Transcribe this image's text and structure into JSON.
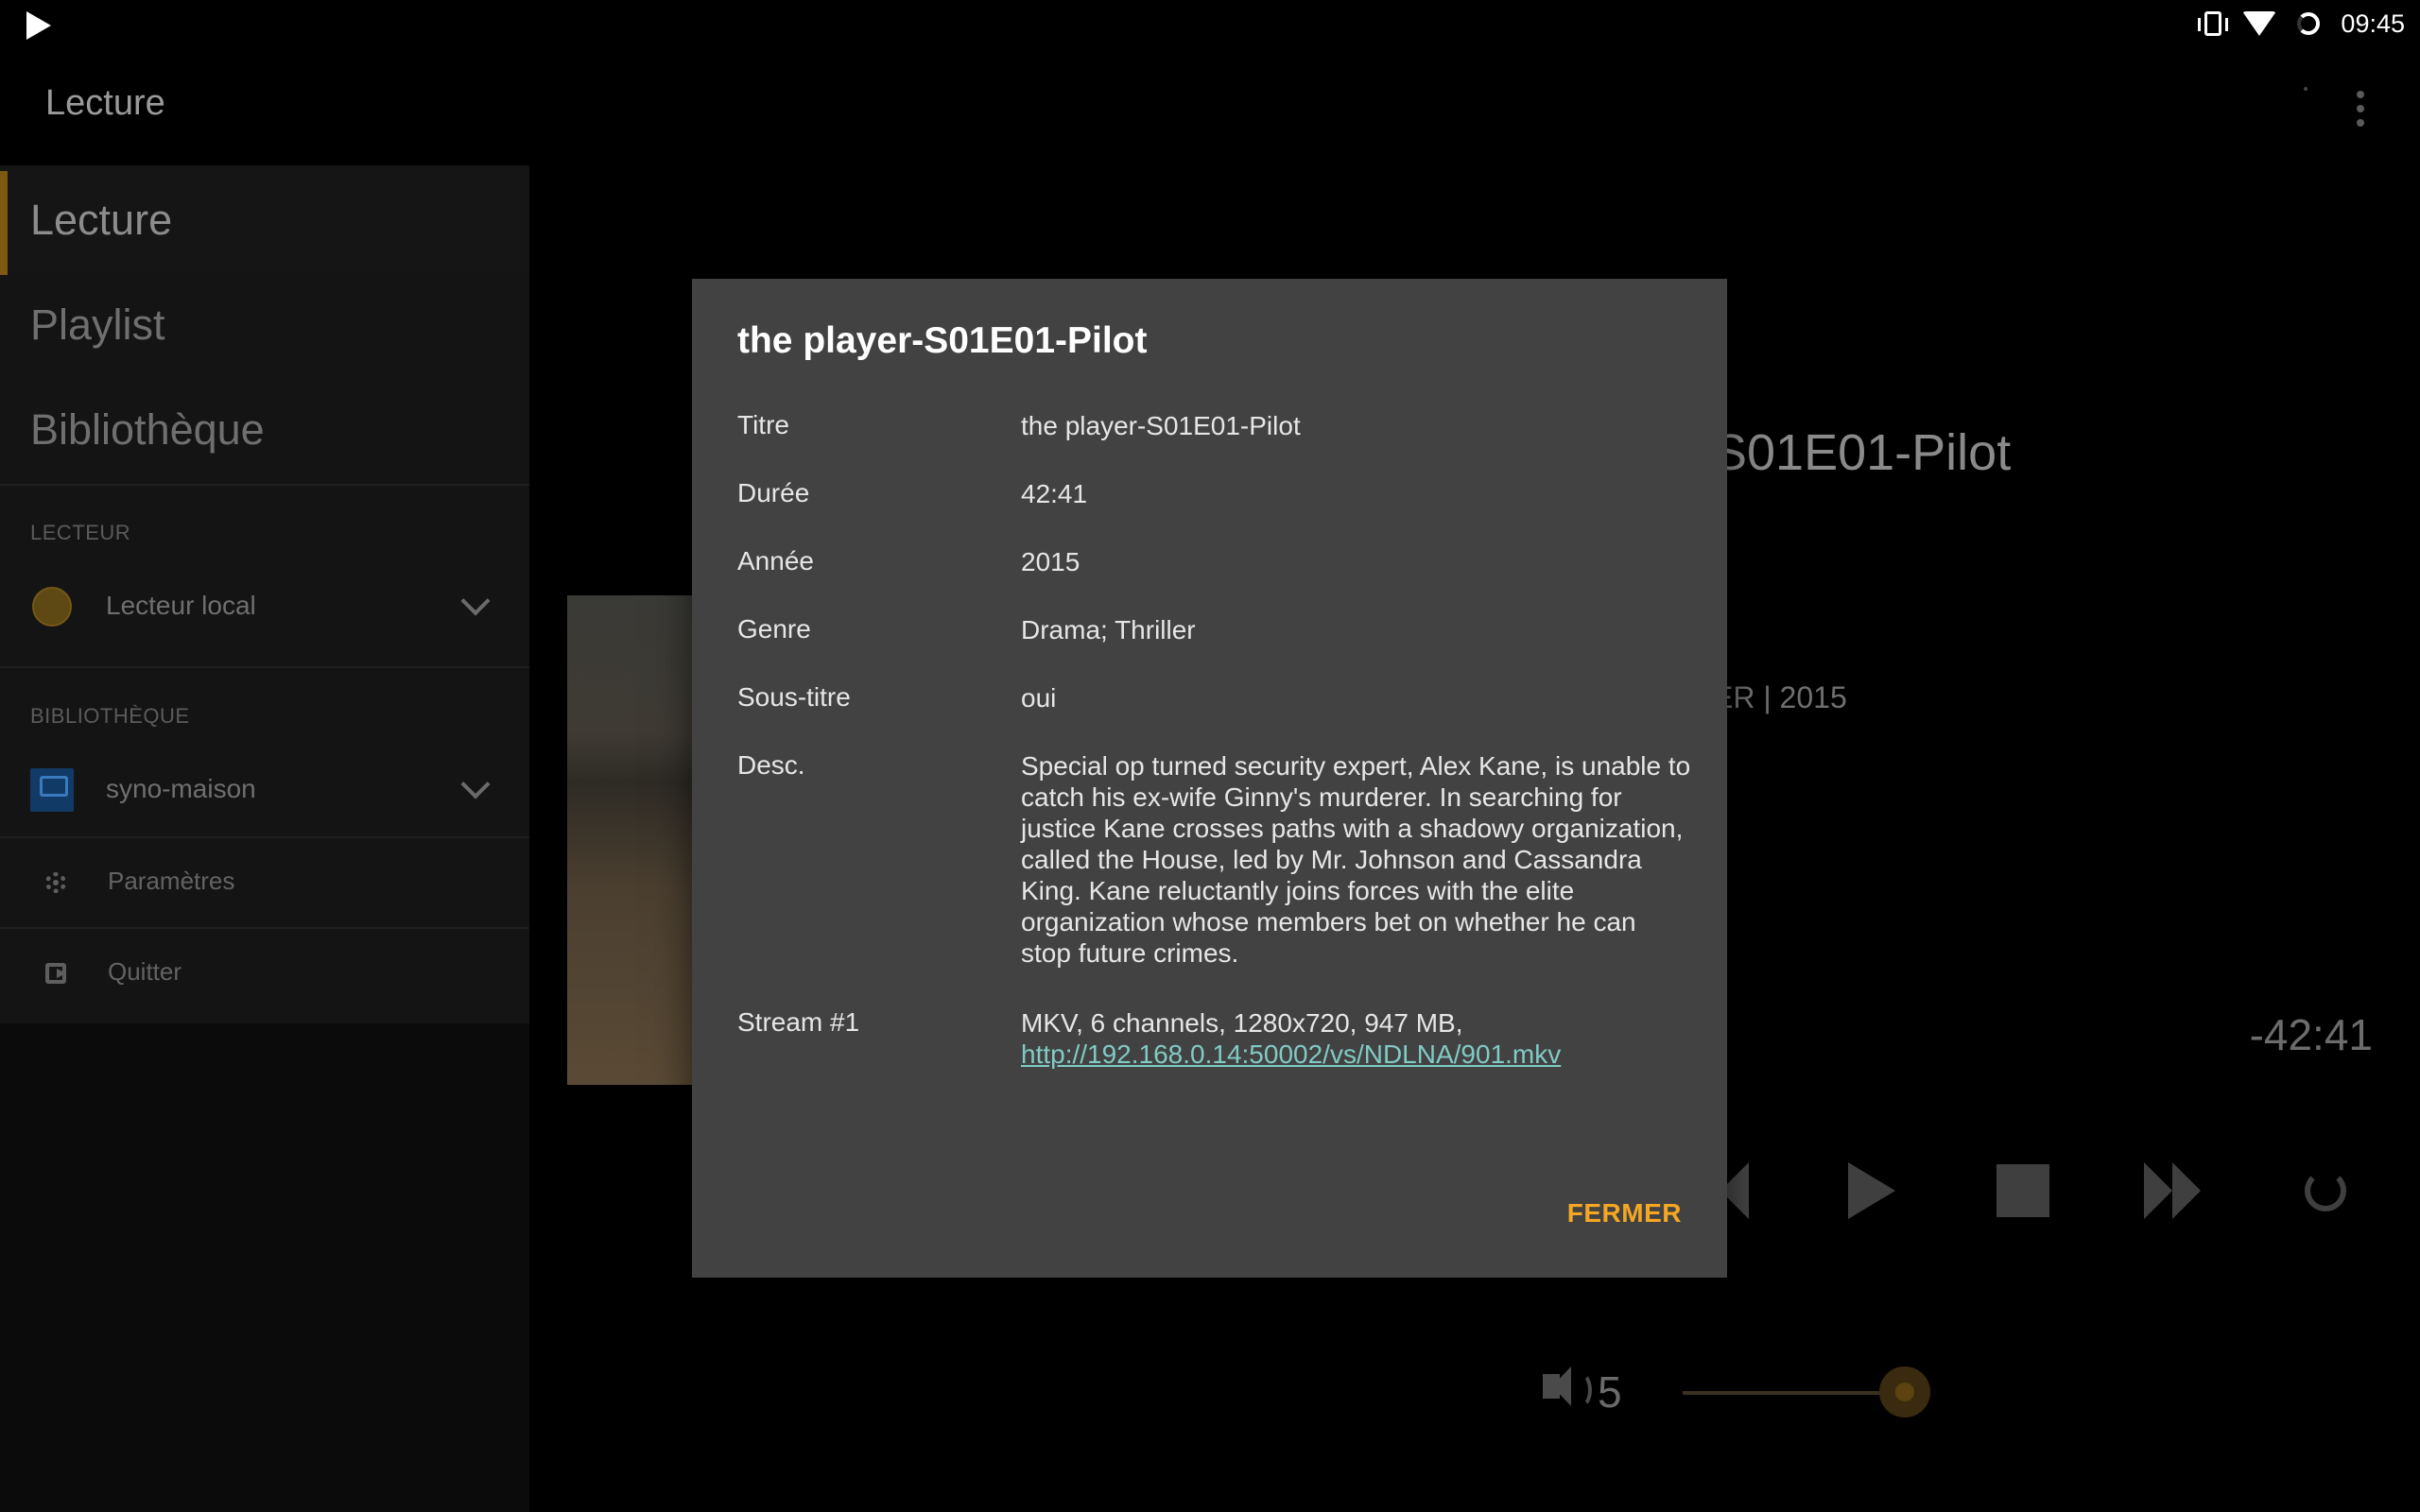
{
  "status_bar": {
    "time": "09:45",
    "icons": [
      "play-icon",
      "vibrate-icon",
      "wifi-icon",
      "loading-icon"
    ]
  },
  "app_bar": {
    "title": "Lecture",
    "menu_icon": "more-vert-icon"
  },
  "drawer": {
    "nav_items": [
      {
        "label": "Lecture",
        "active": true
      },
      {
        "label": "Playlist",
        "active": false
      },
      {
        "label": "Bibliothèque",
        "active": false
      }
    ],
    "player_section": {
      "header": "LECTEUR",
      "selected": "Lecteur local"
    },
    "library_section": {
      "header": "BIBLIOTHÈQUE",
      "selected": "syno-maison"
    },
    "settings_label": "Paramètres",
    "quit_label": "Quitter"
  },
  "player": {
    "title_partial": "S01E01-Pilot",
    "meta_partial": "ER | 2015",
    "remaining": "-42:41",
    "volume": "5",
    "volume_level": 0.5
  },
  "dialog": {
    "title": "the player-S01E01-Pilot",
    "rows": [
      {
        "key": "Titre",
        "value": "the player-S01E01-Pilot"
      },
      {
        "key": "Durée",
        "value": "42:41"
      },
      {
        "key": "Année",
        "value": "2015"
      },
      {
        "key": "Genre",
        "value": "Drama; Thriller"
      },
      {
        "key": "Sous-titre",
        "value": "oui"
      },
      {
        "key": "Desc.",
        "value": "Special op turned security expert, Alex Kane, is unable to catch his ex-wife Ginny's murderer. In searching for justice Kane crosses paths with a shadowy organization, called the House, led by Mr. Johnson and Cassandra King. Kane reluctantly joins forces with the elite organization whose members bet on whether he can stop future crimes."
      }
    ],
    "stream": {
      "key": "Stream #1",
      "info": "MKV, 6 channels, 1280x720, 947 MB, ",
      "link": "http://192.168.0.14:50002/vs/NDLNA/901.mkv"
    },
    "close_label": "FERMER"
  },
  "colors": {
    "accent": "#f5a623",
    "link": "#80cbc4",
    "dialog_bg": "#424242"
  }
}
